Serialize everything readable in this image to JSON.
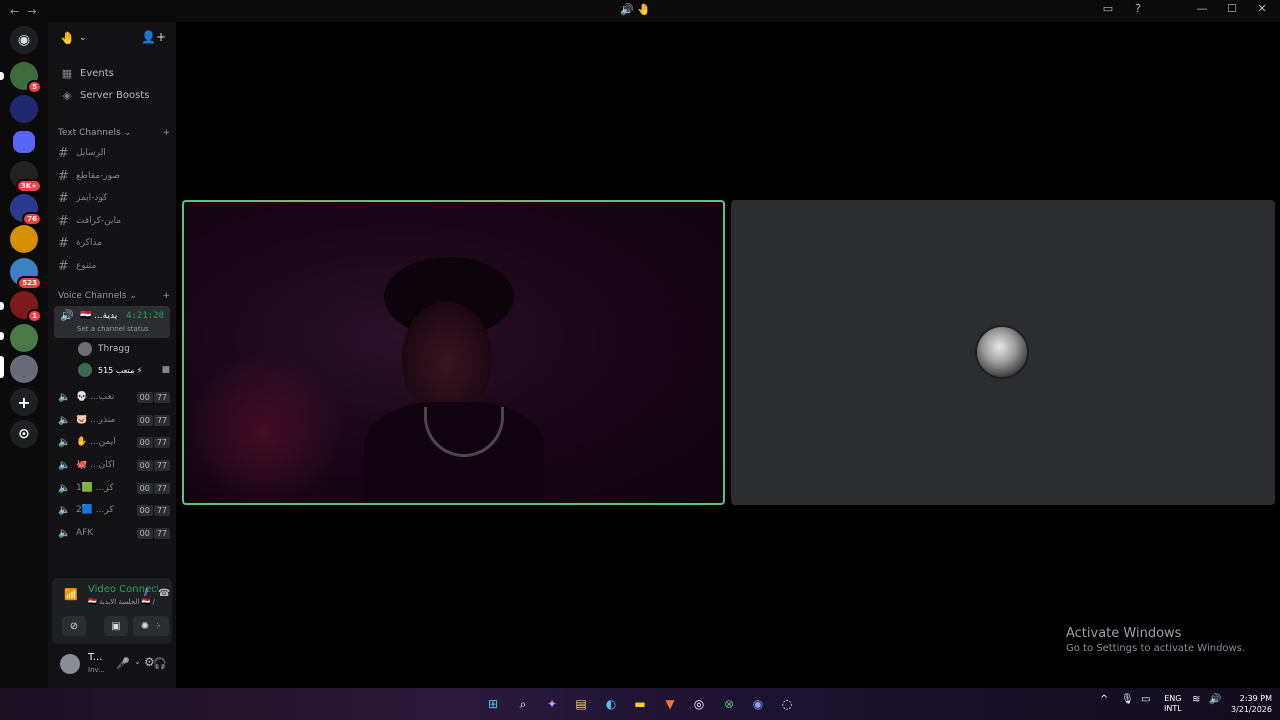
{
  "titlebar": {
    "back": "←",
    "forward": "→",
    "title_icons": "🔊 🤚",
    "inbox": "▭",
    "help": "?",
    "minimize": "—",
    "maximize": "☐",
    "close": "✕"
  },
  "rail": {
    "discord_home": "◉",
    "servers": [
      {
        "badge": "5",
        "color": "#3d6b3d"
      },
      {
        "badge": "",
        "color": "#1f2a6e"
      },
      {
        "badge": "",
        "color": "#5865f2"
      },
      {
        "badge": "3K+",
        "color": "#222222"
      },
      {
        "badge": "76",
        "color": "#2b3a8c"
      },
      {
        "badge": "",
        "color": "#d49000"
      },
      {
        "badge": "523",
        "color": "#3b82c4"
      },
      {
        "badge": "1",
        "color": "#7a1a1a"
      },
      {
        "badge": "",
        "color": "#4a7a4a"
      },
      {
        "badge": "",
        "color": "#6a6a7a"
      }
    ],
    "add_server": "+",
    "discover": "⊙"
  },
  "sidebar": {
    "server_name": "🤚",
    "events": "Events",
    "server_boosts": "Server Boosts",
    "text_category": "Text Channels",
    "text_channels": [
      "الرسايل",
      "صور-مقاطع",
      "كود-ايمز",
      "ماين-كرافت",
      "مذاكرة",
      "متنوع"
    ],
    "voice_category": "Voice Channels",
    "active_voice": {
      "name": "🇪🇬 ...يدية",
      "timer": "4:21:28",
      "status": "Set a channel status"
    },
    "members": [
      {
        "name": "Thragg"
      },
      {
        "name": "متعب 515 ⚡"
      }
    ],
    "voice_channels": [
      {
        "name": "💀 ...تعب",
        "a": "00",
        "b": "77"
      },
      {
        "name": "🐷 ...منذر",
        "a": "00",
        "b": "77"
      },
      {
        "name": "✋ ...ايمن",
        "a": "00",
        "b": "77"
      },
      {
        "name": "🐙 ...اكان",
        "a": "00",
        "b": "77"
      },
      {
        "name": "1🟩 ...كر",
        "a": "00",
        "b": "77"
      },
      {
        "name": "2🟦 ...كر",
        "a": "00",
        "b": "77"
      },
      {
        "name": "AFK",
        "a": "00",
        "b": "77"
      }
    ],
    "plus": "+",
    "chevron": "⌄"
  },
  "voice_panel": {
    "connected": "Video Connected",
    "subtitle": "🇪🇬 الجلسة الابدية 🇪🇬 / ...",
    "user_name": "T...",
    "user_status": "Inv..."
  },
  "stage": {
    "activate_title": "Activate Windows",
    "activate_sub": "Go to Settings to activate Windows."
  },
  "taskbar": {
    "lang_top": "ENG",
    "lang_bottom": "INTL",
    "time": "2:39 PM",
    "date": "3/21/2026"
  }
}
